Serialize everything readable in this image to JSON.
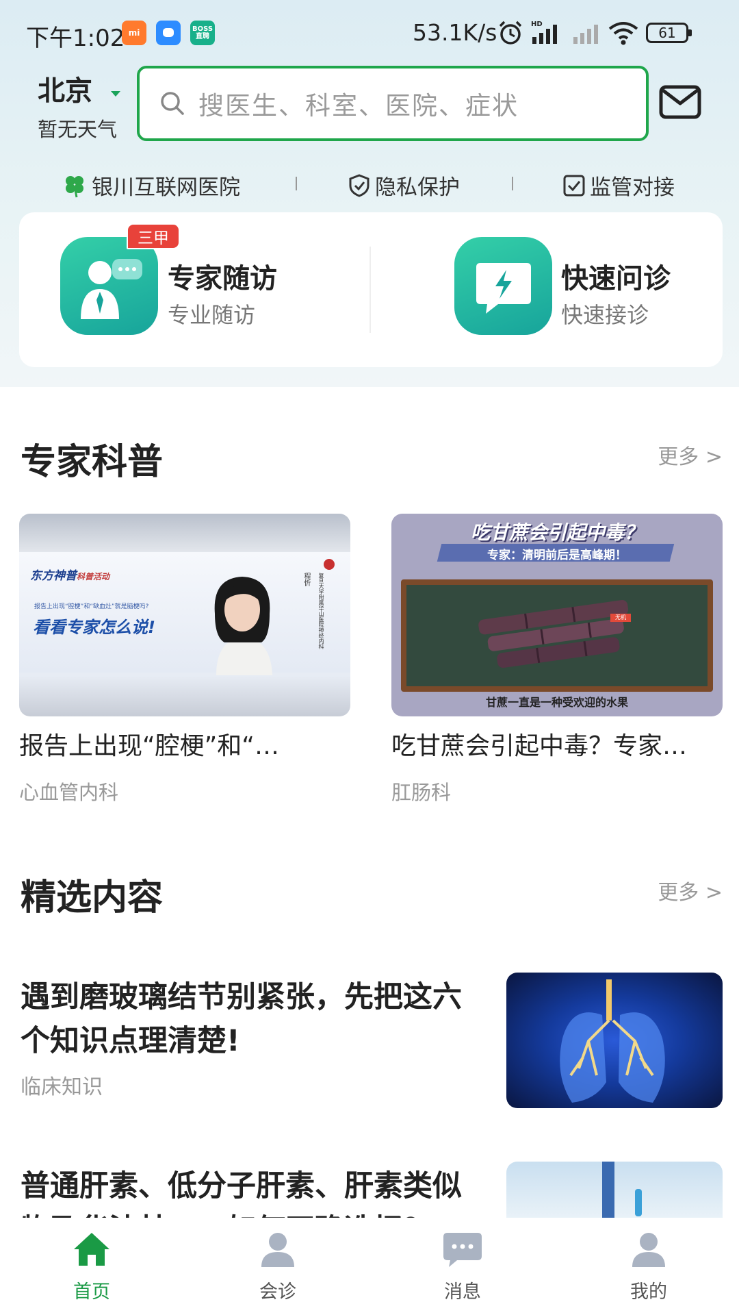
{
  "status_bar": {
    "time": "下午1:02",
    "apps": [
      "小米商城",
      "消息",
      "BOSS直聘"
    ],
    "network_speed": "53.1K/s",
    "battery": "61"
  },
  "header": {
    "city": "北京",
    "weather": "暂无天气",
    "search_placeholder": "搜医生、科室、医院、症状"
  },
  "trust_bar": {
    "hospital": "银川互联网医院",
    "privacy": "隐私保护",
    "supervision": "监管对接"
  },
  "services": [
    {
      "title": "专家随访",
      "subtitle": "专业随访",
      "badge": "三甲"
    },
    {
      "title": "快速问诊",
      "subtitle": "快速接诊"
    }
  ],
  "popular": {
    "title": "专家科普",
    "more": "更多 >",
    "items": [
      {
        "title": "报告上出现“腔梗”和“…",
        "tag": "心血管内科",
        "thumb": {
          "brand": "东方神普",
          "brand_sub": "科普活动",
          "caption_small": "报告上出现“腔梗”和“缺血灶”就是脑梗吗?",
          "caption_big": "看看专家怎么说!",
          "name": "程忻",
          "org": "复旦大学附属华山医院神经内科"
        }
      },
      {
        "title": "吃甘蔗会引起中毒？专家…",
        "tag": "肛肠科",
        "thumb": {
          "headline": "吃甘蔗会引起中毒？",
          "subline": "专家：清明前后是高峰期！",
          "footer": "甘蔗一直是一种受欢迎的水果",
          "label": "无机"
        }
      }
    ]
  },
  "featured": {
    "title": "精选内容",
    "more": "更多 >",
    "items": [
      {
        "title": "遇到磨玻璃结节别紧张，先把这六个知识点理清楚!",
        "tag": "临床知识"
      },
      {
        "title": "普通肝素、低分子肝素、肝素类似物及华法林……如何正确选择？",
        "tag": ""
      }
    ]
  },
  "tabbar": {
    "items": [
      {
        "label": "首页",
        "active": true
      },
      {
        "label": "会诊",
        "active": false
      },
      {
        "label": "消息",
        "active": false
      },
      {
        "label": "我的",
        "active": false
      }
    ]
  },
  "colors": {
    "brand_green": "#1fa64b",
    "teal": "#1fb8a0",
    "badge_red": "#e8423a"
  }
}
